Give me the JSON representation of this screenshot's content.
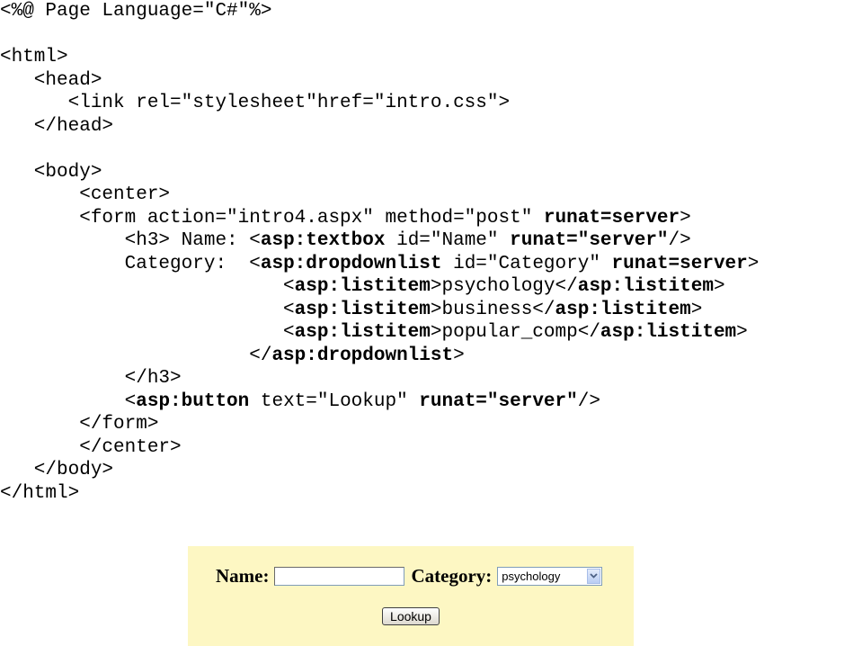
{
  "code": {
    "lines": [
      [
        {
          "t": "<%@ Page Language=\"C#\"%>",
          "b": false
        }
      ],
      [
        {
          "t": "",
          "b": false
        }
      ],
      [
        {
          "t": "<html>",
          "b": false
        }
      ],
      [
        {
          "t": "   <head>",
          "b": false
        }
      ],
      [
        {
          "t": "      <link rel=\"stylesheet\"href=\"intro.css\">",
          "b": false
        }
      ],
      [
        {
          "t": "   </head>",
          "b": false
        }
      ],
      [
        {
          "t": "",
          "b": false
        }
      ],
      [
        {
          "t": "   <body>",
          "b": false
        }
      ],
      [
        {
          "t": "       <center>",
          "b": false
        }
      ],
      [
        {
          "t": "       <form action=\"intro4.aspx\" method=\"post\" ",
          "b": false
        },
        {
          "t": "runat=server",
          "b": true
        },
        {
          "t": ">",
          "b": false
        }
      ],
      [
        {
          "t": "           <h3> Name: <",
          "b": false
        },
        {
          "t": "asp:textbox",
          "b": true
        },
        {
          "t": " id=\"Name\" ",
          "b": false
        },
        {
          "t": "runat=\"server\"",
          "b": true
        },
        {
          "t": "/>",
          "b": false
        }
      ],
      [
        {
          "t": "           Category:  <",
          "b": false
        },
        {
          "t": "asp:dropdownlist",
          "b": true
        },
        {
          "t": " id=\"Category\" ",
          "b": false
        },
        {
          "t": "runat=server",
          "b": true
        },
        {
          "t": ">",
          "b": false
        }
      ],
      [
        {
          "t": "                         <",
          "b": false
        },
        {
          "t": "asp:listitem",
          "b": true
        },
        {
          "t": ">psychology</",
          "b": false
        },
        {
          "t": "asp:listitem",
          "b": true
        },
        {
          "t": ">",
          "b": false
        }
      ],
      [
        {
          "t": "                         <",
          "b": false
        },
        {
          "t": "asp:listitem",
          "b": true
        },
        {
          "t": ">business</",
          "b": false
        },
        {
          "t": "asp:listitem",
          "b": true
        },
        {
          "t": ">",
          "b": false
        }
      ],
      [
        {
          "t": "                         <",
          "b": false
        },
        {
          "t": "asp:listitem",
          "b": true
        },
        {
          "t": ">popular_comp</",
          "b": false
        },
        {
          "t": "asp:listitem",
          "b": true
        },
        {
          "t": ">",
          "b": false
        }
      ],
      [
        {
          "t": "                      </",
          "b": false
        },
        {
          "t": "asp:dropdownlist",
          "b": true
        },
        {
          "t": ">",
          "b": false
        }
      ],
      [
        {
          "t": "           </h3>",
          "b": false
        }
      ],
      [
        {
          "t": "           <",
          "b": false
        },
        {
          "t": "asp:button",
          "b": true
        },
        {
          "t": " text=\"Lookup\" ",
          "b": false
        },
        {
          "t": "runat=\"server\"",
          "b": true
        },
        {
          "t": "/>",
          "b": false
        }
      ],
      [
        {
          "t": "       </form>",
          "b": false
        }
      ],
      [
        {
          "t": "       </center>",
          "b": false
        }
      ],
      [
        {
          "t": "   </body>",
          "b": false
        }
      ],
      [
        {
          "t": "</html>",
          "b": false
        }
      ]
    ]
  },
  "preview": {
    "background": "#fdf7c3",
    "name_label": "Name:",
    "name_value": "",
    "category_label": "Category:",
    "category_selected": "psychology",
    "dropdown_icon": "chevron-down-icon",
    "button_label": "Lookup"
  }
}
